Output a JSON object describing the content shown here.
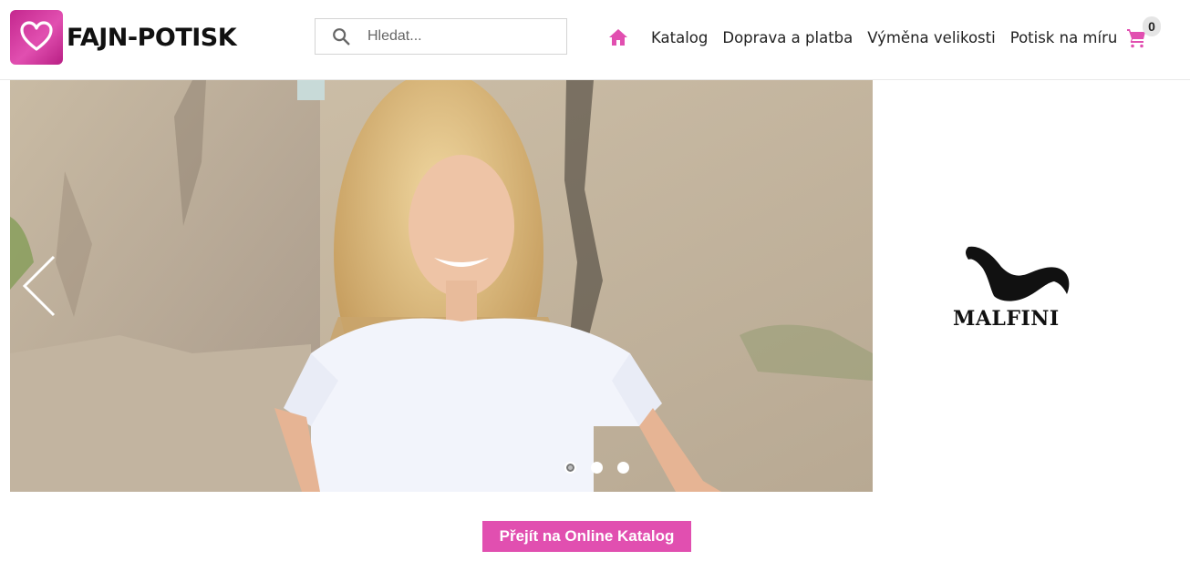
{
  "header": {
    "logo_text": "FAJN-POTISK",
    "search": {
      "placeholder": "Hledat..."
    },
    "nav": [
      {
        "label": "Katalog"
      },
      {
        "label": "Doprava a platba"
      },
      {
        "label": "Výměna velikosti"
      },
      {
        "label": "Potisk na míru"
      }
    ],
    "cart": {
      "count": "0"
    },
    "icons": [
      "heart-logo-icon",
      "search-icon",
      "home-icon",
      "cart-icon"
    ]
  },
  "hero": {
    "slide_count": 3,
    "active_slide": 1,
    "brand_logo_text": "MALFINI"
  },
  "cta": {
    "label": "Přejít na Online Katalog"
  },
  "colors": {
    "accent": "#e14fb0",
    "text": "#222222",
    "border": "#d4d4d4"
  }
}
